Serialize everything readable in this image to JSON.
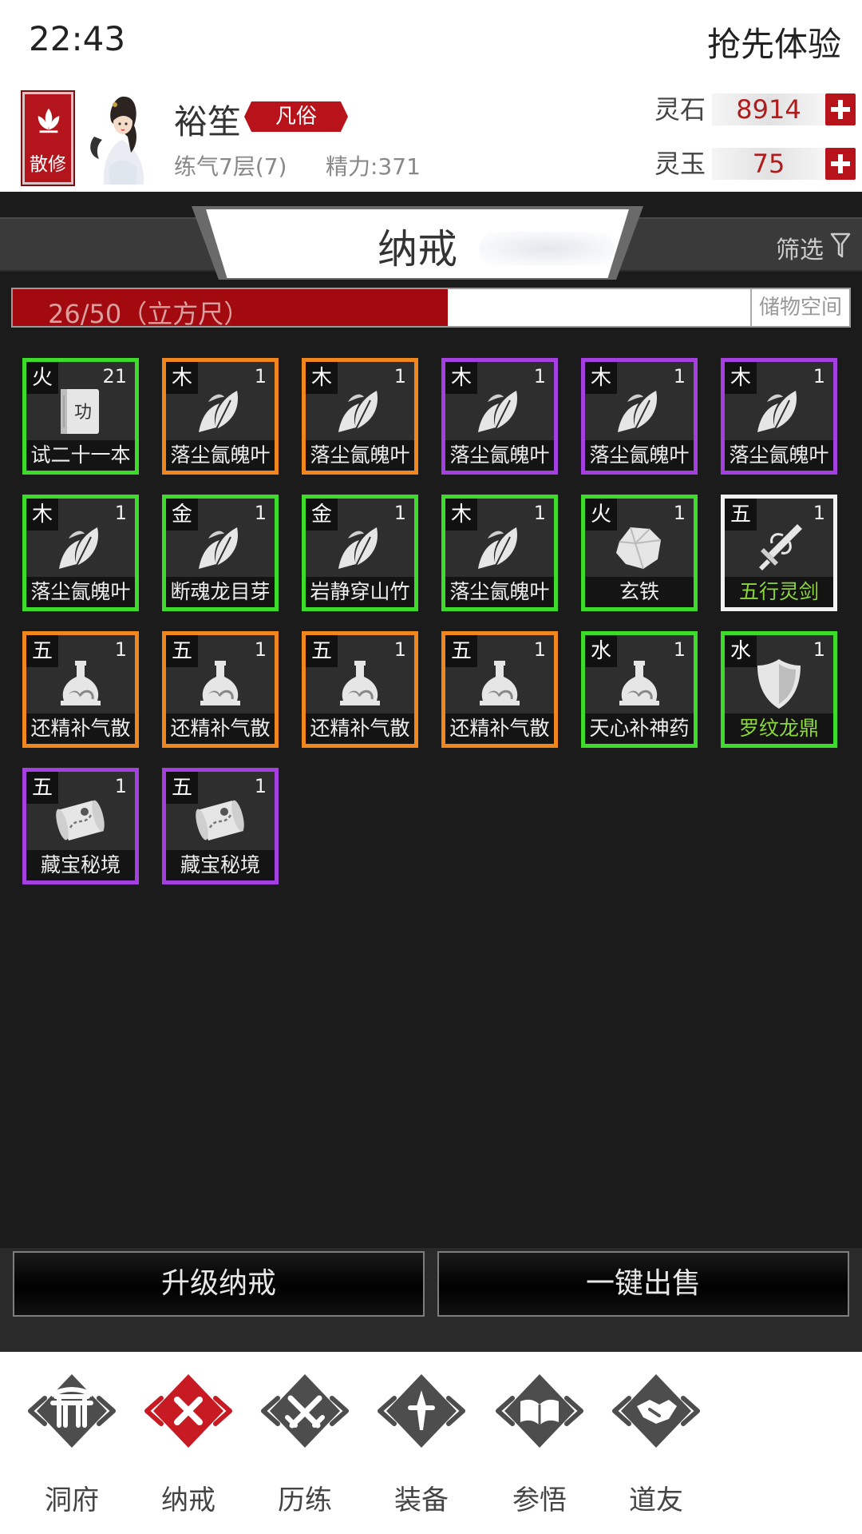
{
  "status_bar": {
    "time": "22:43",
    "promo": "抢先体验"
  },
  "profile": {
    "sect_label": "散修",
    "name": "裕笙",
    "rank": "凡俗",
    "cultivation": "练气7层(7)",
    "energy": "精力:371",
    "currencies": [
      {
        "name": "灵石",
        "value": "8914"
      },
      {
        "name": "灵玉",
        "value": "75"
      }
    ]
  },
  "page": {
    "title": "纳戒",
    "filter_label": "筛选"
  },
  "capacity": {
    "text": "26/50（立方尺）",
    "used": 26,
    "total": 50,
    "storage_label": "储物空间"
  },
  "inventory": [
    {
      "element": "火",
      "qty": "21",
      "name": "试二十一本",
      "rarity": "green",
      "icon": "manual-icon"
    },
    {
      "element": "木",
      "qty": "1",
      "name": "落尘氤魄叶",
      "rarity": "orange",
      "icon": "leaf-icon"
    },
    {
      "element": "木",
      "qty": "1",
      "name": "落尘氤魄叶",
      "rarity": "orange",
      "icon": "leaf-icon"
    },
    {
      "element": "木",
      "qty": "1",
      "name": "落尘氤魄叶",
      "rarity": "purple",
      "icon": "leaf-icon"
    },
    {
      "element": "木",
      "qty": "1",
      "name": "落尘氤魄叶",
      "rarity": "purple",
      "icon": "leaf-icon"
    },
    {
      "element": "木",
      "qty": "1",
      "name": "落尘氤魄叶",
      "rarity": "purple",
      "icon": "leaf-icon"
    },
    {
      "element": "木",
      "qty": "1",
      "name": "落尘氤魄叶",
      "rarity": "green",
      "icon": "leaf-icon"
    },
    {
      "element": "金",
      "qty": "1",
      "name": "断魂龙目芽",
      "rarity": "green",
      "icon": "leaf-icon"
    },
    {
      "element": "金",
      "qty": "1",
      "name": "岩静穿山竹",
      "rarity": "green",
      "icon": "leaf-icon"
    },
    {
      "element": "木",
      "qty": "1",
      "name": "落尘氤魄叶",
      "rarity": "green",
      "icon": "leaf-icon"
    },
    {
      "element": "火",
      "qty": "1",
      "name": "玄铁",
      "rarity": "green",
      "icon": "ore-icon"
    },
    {
      "element": "五",
      "qty": "1",
      "name": "五行灵剑",
      "rarity": "white",
      "icon": "sword-icon",
      "special": true
    },
    {
      "element": "五",
      "qty": "1",
      "name": "还精补气散",
      "rarity": "orange",
      "icon": "flask-icon"
    },
    {
      "element": "五",
      "qty": "1",
      "name": "还精补气散",
      "rarity": "orange",
      "icon": "flask-icon"
    },
    {
      "element": "五",
      "qty": "1",
      "name": "还精补气散",
      "rarity": "orange",
      "icon": "flask-icon"
    },
    {
      "element": "五",
      "qty": "1",
      "name": "还精补气散",
      "rarity": "orange",
      "icon": "flask-icon"
    },
    {
      "element": "水",
      "qty": "1",
      "name": "天心补神药",
      "rarity": "green",
      "icon": "flask-icon"
    },
    {
      "element": "水",
      "qty": "1",
      "name": "罗纹龙鼎",
      "rarity": "green",
      "icon": "shield-icon",
      "special": true
    },
    {
      "element": "五",
      "qty": "1",
      "name": "藏宝秘境",
      "rarity": "purple",
      "icon": "map-scroll-icon"
    },
    {
      "element": "五",
      "qty": "1",
      "name": "藏宝秘境",
      "rarity": "purple",
      "icon": "map-scroll-icon"
    }
  ],
  "actions": {
    "upgrade": "升级纳戒",
    "sell_all": "一键出售"
  },
  "nav": [
    {
      "label": "洞府",
      "icon": "gate-icon",
      "active": false
    },
    {
      "label": "纳戒",
      "icon": "close-icon",
      "active": true
    },
    {
      "label": "历练",
      "icon": "crossed-swords-icon",
      "active": false
    },
    {
      "label": "装备",
      "icon": "dagger-icon",
      "active": false
    },
    {
      "label": "参悟",
      "icon": "open-book-icon",
      "active": false
    },
    {
      "label": "道友",
      "icon": "handshake-icon",
      "active": false
    }
  ],
  "colors": {
    "brand_red": "#b8131b",
    "rarity_green": "#3ddc2a",
    "rarity_orange": "#f0871e",
    "rarity_purple": "#a43fe0",
    "rarity_white": "#f2f2f2",
    "special_name": "#8bd63a"
  }
}
